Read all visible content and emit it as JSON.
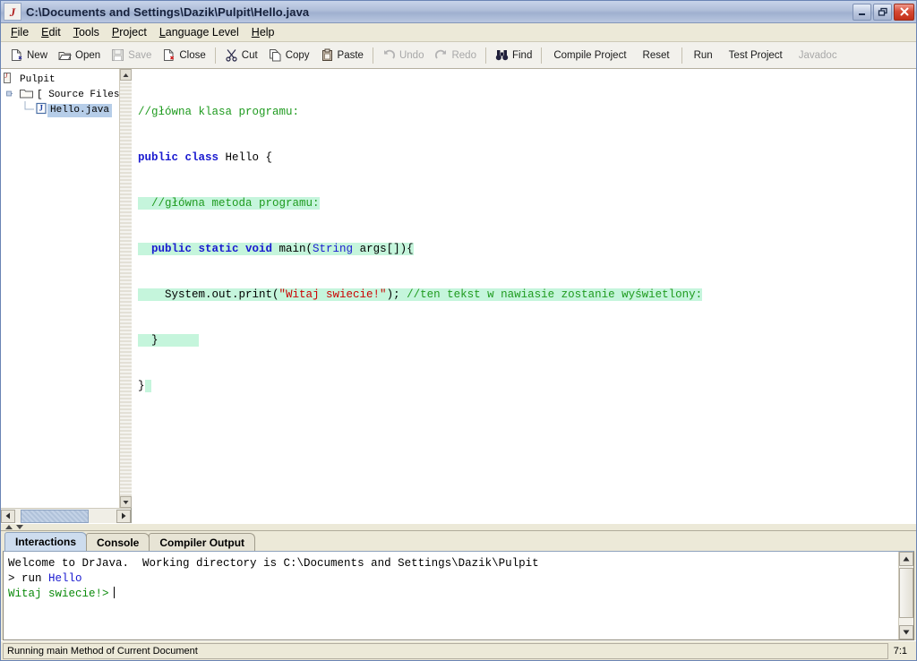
{
  "window": {
    "title": "C:\\Documents and Settings\\Dazik\\Pulpit\\Hello.java",
    "app_icon": "J",
    "minimize_label": "Minimize",
    "restore_label": "Restore",
    "close_label": "Close"
  },
  "menubar": {
    "items": [
      {
        "label": "File",
        "mnemonic": "F",
        "rest": "ile"
      },
      {
        "label": "Edit",
        "mnemonic": "E",
        "rest": "dit"
      },
      {
        "label": "Tools",
        "mnemonic": "T",
        "rest": "ools"
      },
      {
        "label": "Project",
        "mnemonic": "P",
        "rest": "roject"
      },
      {
        "label": "Language Level",
        "mnemonic": "L",
        "rest": "anguage Level"
      },
      {
        "label": "Help",
        "mnemonic": "H",
        "rest": "elp"
      }
    ]
  },
  "toolbar": {
    "new_label": "New",
    "open_label": "Open",
    "save_label": "Save",
    "close_label": "Close",
    "cut_label": "Cut",
    "copy_label": "Copy",
    "paste_label": "Paste",
    "undo_label": "Undo",
    "redo_label": "Redo",
    "find_label": "Find",
    "compile_project_label": "Compile Project",
    "reset_label": "Reset",
    "run_label": "Run",
    "test_project_label": "Test Project",
    "javadoc_label": "Javadoc"
  },
  "tree": {
    "root_label": "Pulpit",
    "source_files_label": "[ Source Files ]",
    "file_label": "Hello.java",
    "file_icon_letter": "J"
  },
  "editor": {
    "lines": [
      {
        "segments": [
          {
            "text": "//główna klasa programu:",
            "cls": "cm"
          }
        ],
        "selected": false
      },
      {
        "segments": [
          {
            "text": "public class ",
            "cls": "kw"
          },
          {
            "text": "Hello {",
            "cls": "pl"
          }
        ],
        "selected": false
      },
      {
        "segments": [
          {
            "text": "  //główna metoda programu:",
            "cls": "cm"
          }
        ],
        "selected": true
      },
      {
        "segments": [
          {
            "text": "  public static void ",
            "cls": "kw"
          },
          {
            "text": "main(",
            "cls": "pl"
          },
          {
            "text": "String",
            "cls": "kw2"
          },
          {
            "text": " args[]){",
            "cls": "pl"
          }
        ],
        "selected": true
      },
      {
        "segments": [
          {
            "text": "    System.out.print(",
            "cls": "pl"
          },
          {
            "text": "\"Witaj swiecie!\"",
            "cls": "str"
          },
          {
            "text": "); ",
            "cls": "pl"
          },
          {
            "text": "//ten tekst w nawiasie zostanie wyświetlony:",
            "cls": "cm"
          }
        ],
        "selected": true
      },
      {
        "segments": [
          {
            "text": "  }",
            "cls": "pl"
          }
        ],
        "selected": true
      },
      {
        "segments": [
          {
            "text": "}",
            "cls": "pl"
          }
        ],
        "selected": false
      }
    ]
  },
  "tabs": {
    "items": [
      {
        "label": "Interactions",
        "active": true
      },
      {
        "label": "Console",
        "active": false
      },
      {
        "label": "Compiler Output",
        "active": false
      }
    ]
  },
  "interactions": {
    "welcome": "Welcome to DrJava.  Working directory is C:\\Documents and Settings\\Dazik\\Pulpit",
    "prompt_symbol": "> ",
    "command_run": "run ",
    "command_arg": "Hello",
    "output": "Witaj swiecie!>"
  },
  "statusbar": {
    "message": "Running main Method of Current Document",
    "position": "7:1"
  },
  "colors": {
    "title_bar": "#aebdd8",
    "accent_tab": "#cddcee",
    "selection": "#c5f5dc",
    "comment": "#1f9b1f",
    "keyword": "#1a1ad0",
    "string": "#cc0000",
    "tree_selection": "#b6cde8",
    "close_button": "#c32e18"
  }
}
